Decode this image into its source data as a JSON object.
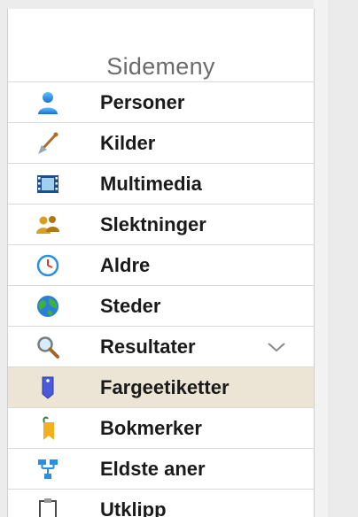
{
  "sidebar": {
    "title": "Sidemeny",
    "items": [
      {
        "label": "Personer",
        "icon": "person-icon"
      },
      {
        "label": "Kilder",
        "icon": "shovel-icon"
      },
      {
        "label": "Multimedia",
        "icon": "filmstrip-icon"
      },
      {
        "label": "Slektninger",
        "icon": "relatives-icon"
      },
      {
        "label": "Aldre",
        "icon": "clock-icon"
      },
      {
        "label": "Steder",
        "icon": "globe-icon"
      },
      {
        "label": "Resultater",
        "icon": "magnifier-icon",
        "expandable": true
      },
      {
        "label": "Fargeetiketter",
        "icon": "tag-icon",
        "selected": true
      },
      {
        "label": "Bokmerker",
        "icon": "bookmark-icon"
      },
      {
        "label": "Eldste aner",
        "icon": "tree-icon"
      },
      {
        "label": "Utklipp",
        "icon": "clipboard-icon"
      }
    ]
  },
  "colors": {
    "selected_bg": "#ece5d6",
    "accent_blue": "#2a8fe0"
  }
}
